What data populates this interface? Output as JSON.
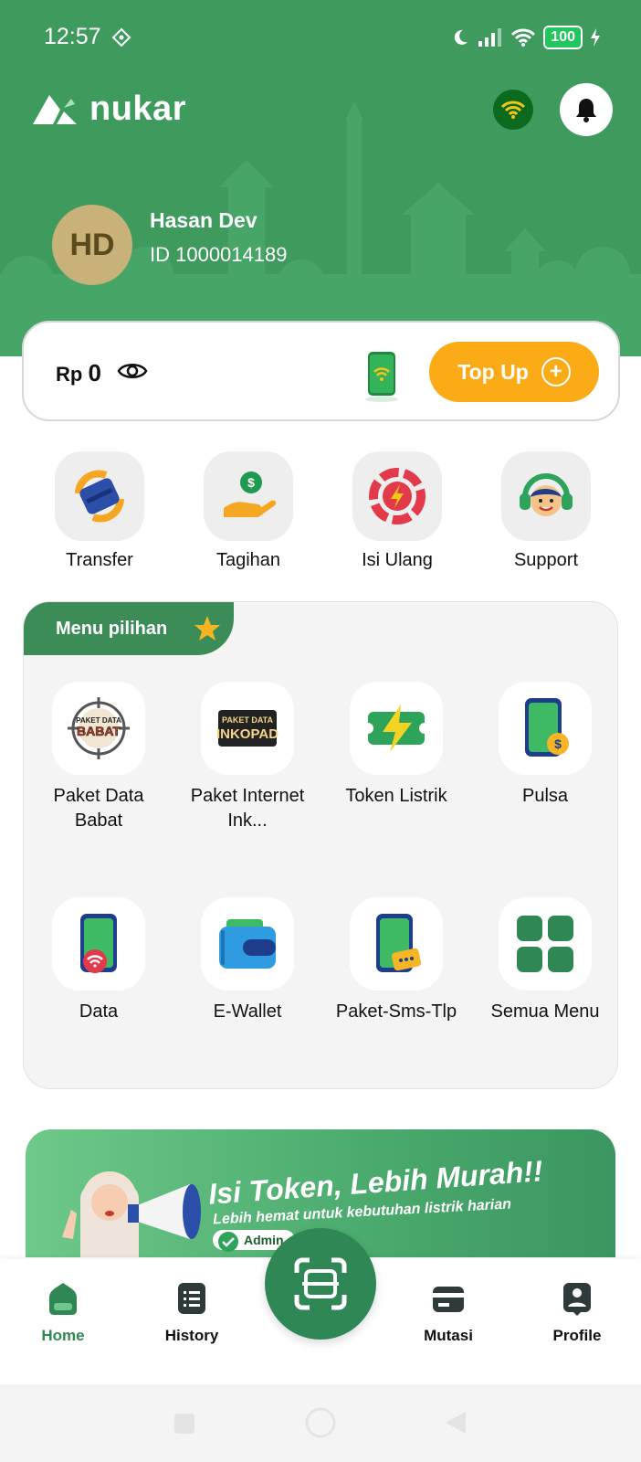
{
  "status_bar": {
    "time": "12:57",
    "battery": "100"
  },
  "app": {
    "name": "nukar"
  },
  "user": {
    "initials": "HD",
    "name": "Hasan Dev",
    "id": "ID 1000014189"
  },
  "balance": {
    "currency": "Rp",
    "amount": "0",
    "topup_label": "Top Up"
  },
  "quick_actions": [
    {
      "label": "Transfer",
      "icon": "transfer-card-icon"
    },
    {
      "label": "Tagihan",
      "icon": "bill-hand-icon"
    },
    {
      "label": "Isi Ulang",
      "icon": "recharge-bolt-icon"
    },
    {
      "label": "Support",
      "icon": "support-headset-icon"
    }
  ],
  "menu": {
    "title": "Menu pilihan",
    "items": [
      {
        "label": "Paket Data Babat",
        "icon": "paket-data-babat-icon",
        "logo_text_top": "PAKET DATA",
        "logo_text_main": "BABAT"
      },
      {
        "label": "Paket Internet Ink...",
        "icon": "paket-inkopad-icon",
        "logo_text_top": "PAKET DATA",
        "logo_text_main": "INKOPAD"
      },
      {
        "label": "Token Listrik",
        "icon": "token-listrik-icon"
      },
      {
        "label": "Pulsa",
        "icon": "pulsa-phone-icon"
      },
      {
        "label": "Data",
        "icon": "data-phone-icon"
      },
      {
        "label": "E-Wallet",
        "icon": "wallet-icon"
      },
      {
        "label": "Paket-Sms-Tlp",
        "icon": "sms-phone-icon"
      },
      {
        "label": "Semua Menu",
        "icon": "grid-icon"
      }
    ]
  },
  "banner": {
    "title": "Isi Token, Lebih Murah!!",
    "subtitle": "Lebih hemat untuk kebutuhan listrik harian",
    "chip": "Admin"
  },
  "bottom_nav": [
    {
      "label": "Home",
      "icon": "home-icon",
      "active": true
    },
    {
      "label": "History",
      "icon": "history-icon",
      "active": false
    },
    {
      "label": "Mutasi",
      "icon": "mutasi-card-icon",
      "active": false
    },
    {
      "label": "Profile",
      "icon": "profile-badge-icon",
      "active": false
    }
  ],
  "colors": {
    "primary": "#3f9a5e",
    "accent": "#fbab16",
    "dark_green": "#2f8755"
  }
}
